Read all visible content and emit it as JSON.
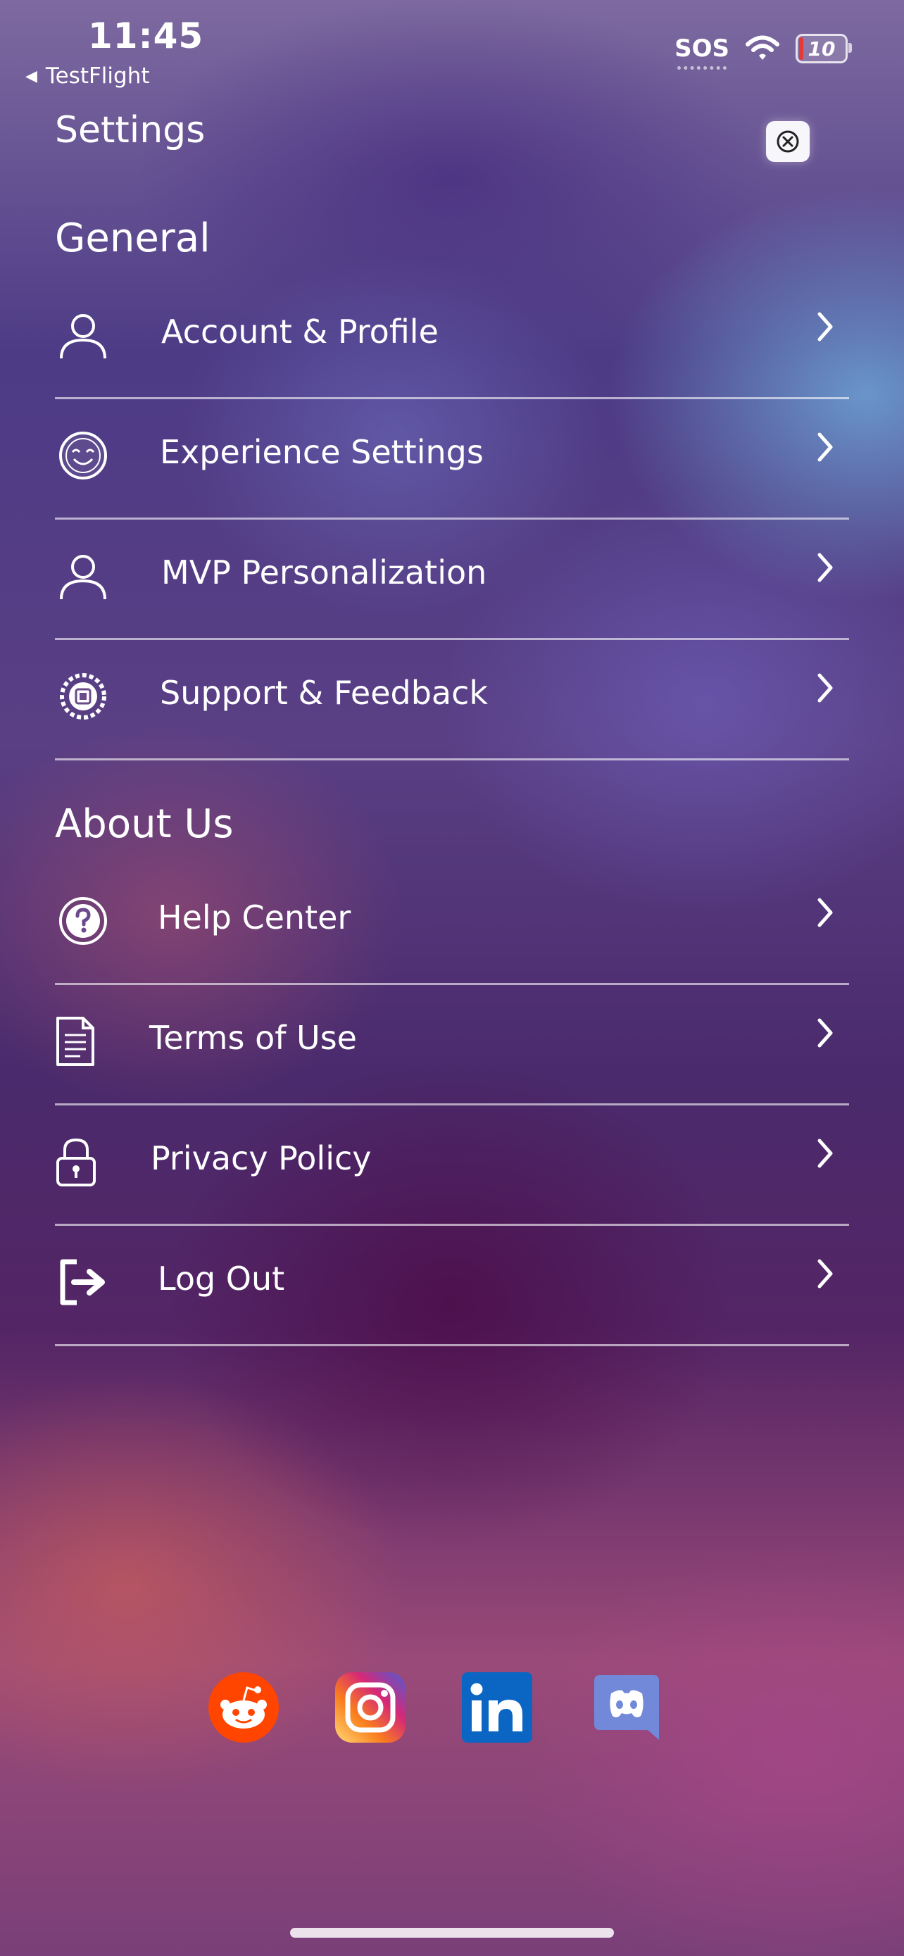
{
  "status_bar": {
    "time": "11:45",
    "back_app": "TestFlight",
    "sos": "SOS",
    "battery": "10"
  },
  "header": {
    "title": "Settings",
    "close_icon": "close-circle-icon"
  },
  "sections": {
    "general": {
      "title": "General",
      "items": [
        {
          "label": "Account & Profile",
          "icon": "person-icon"
        },
        {
          "label": "Experience Settings",
          "icon": "smiley-icon"
        },
        {
          "label": "MVP Personalization",
          "icon": "person-icon"
        },
        {
          "label": "Support & Feedback",
          "icon": "support-icon"
        }
      ]
    },
    "about": {
      "title": "About Us",
      "items": [
        {
          "label": "Help Center",
          "icon": "question-icon"
        },
        {
          "label": "Terms of Use",
          "icon": "document-icon"
        },
        {
          "label": "Privacy Policy",
          "icon": "lock-icon"
        },
        {
          "label": "Log Out",
          "icon": "logout-icon"
        }
      ]
    }
  },
  "social": [
    {
      "name": "reddit",
      "color": "#ff4500"
    },
    {
      "name": "instagram",
      "color": "#d6249f"
    },
    {
      "name": "linkedin",
      "color": "#0a66c2"
    },
    {
      "name": "discord",
      "color": "#7289da"
    }
  ]
}
